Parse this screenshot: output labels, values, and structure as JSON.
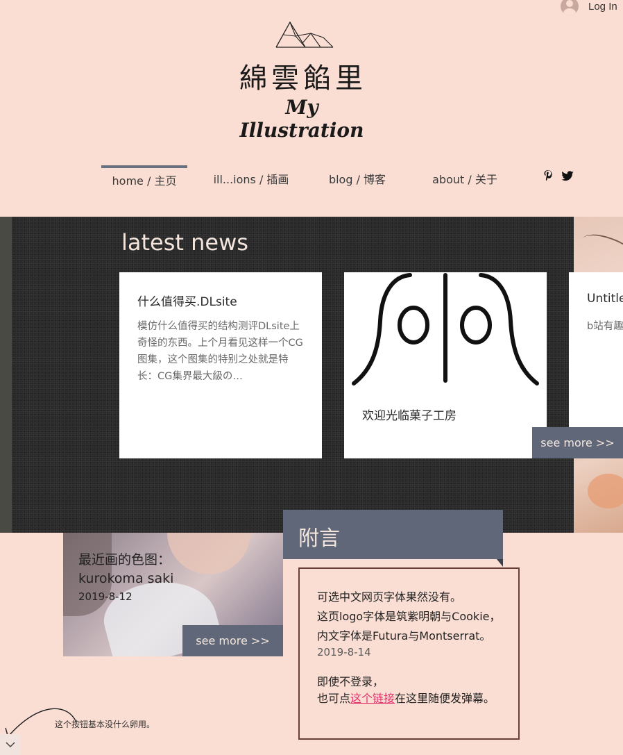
{
  "header": {
    "login_label": "Log In",
    "logo_cn": "綿雲餡里",
    "logo_en": "My Illustration"
  },
  "nav": {
    "items": [
      {
        "label": "home / 主页",
        "active": true
      },
      {
        "label": "ill...ions / 插画",
        "active": false
      },
      {
        "label": "blog / 博客",
        "active": false
      },
      {
        "label": "about / 关于",
        "active": false
      }
    ],
    "social": [
      "pinterest-icon",
      "twitter-icon"
    ]
  },
  "news": {
    "title": "latest news",
    "cards": [
      {
        "title": "什么值得买.DLsite",
        "body": "模仿什么值得买的结构测评DLsite上奇怪的东西。上个月看见这样一个CG图集，这个图集的特别之处就是特长：CG集界最大級の…"
      },
      {
        "title": "欢迎光临菓子工房",
        "body": ""
      },
      {
        "title": "Untitled",
        "body": "b站有趣"
      }
    ],
    "see_more_label": "see more >>"
  },
  "recent": {
    "title_line1": "最近画的色图：",
    "title_line2": "kurokoma saki",
    "date": "2019-8-12",
    "see_more_label": "see more >>"
  },
  "postscript": {
    "heading": "附言",
    "line1": "可选中文网页字体果然没有。",
    "line2": "这页logo字体是筑紫明朝与Cookie，",
    "line3": "内文字体是Futura与Montserrat。",
    "date": "2019-8-14",
    "line4": "即使不登录，",
    "line5_before": "也可点",
    "line5_link": "这个链接",
    "line5_after": "在这里随便发弹幕。"
  },
  "footer": {
    "hint": "这个按钮基本没什么卵用。"
  },
  "colors": {
    "background": "#fbded3",
    "button": "#5f6778",
    "link": "#e0306a"
  }
}
